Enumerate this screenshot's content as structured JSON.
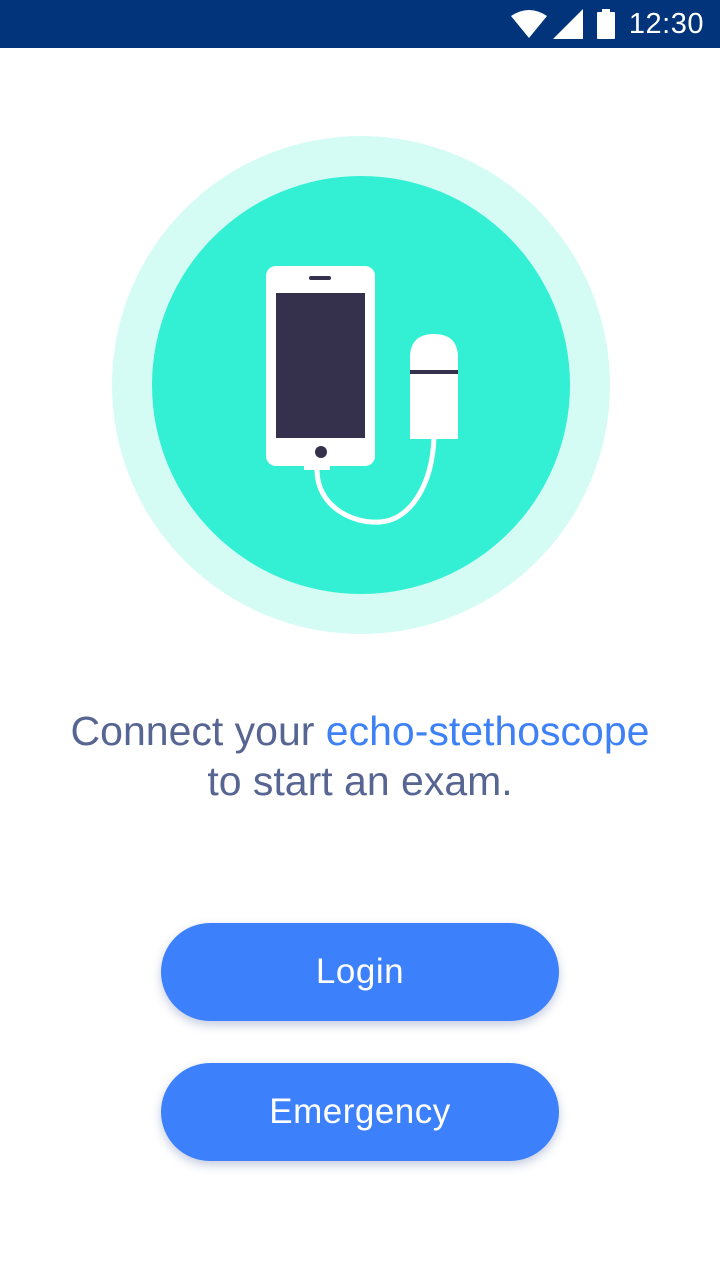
{
  "status_bar": {
    "time": "12:30",
    "icons": [
      "wifi-icon",
      "cellular-signal-icon",
      "battery-icon"
    ],
    "background_color": "#01347a"
  },
  "hero": {
    "icon": "phone-connected-to-probe-illustration",
    "outer_circle_color": "#d5fcf4",
    "inner_circle_color": "#33f0d5",
    "screen_color": "#35304c"
  },
  "message": {
    "prefix": "Connect your ",
    "highlight": "echo-stethoscope",
    "suffix": "to start an exam.",
    "text_color": "#566591",
    "highlight_color": "#3e80f6"
  },
  "buttons": {
    "login_label": "Login",
    "emergency_label": "Emergency",
    "color": "#3d80fc"
  }
}
